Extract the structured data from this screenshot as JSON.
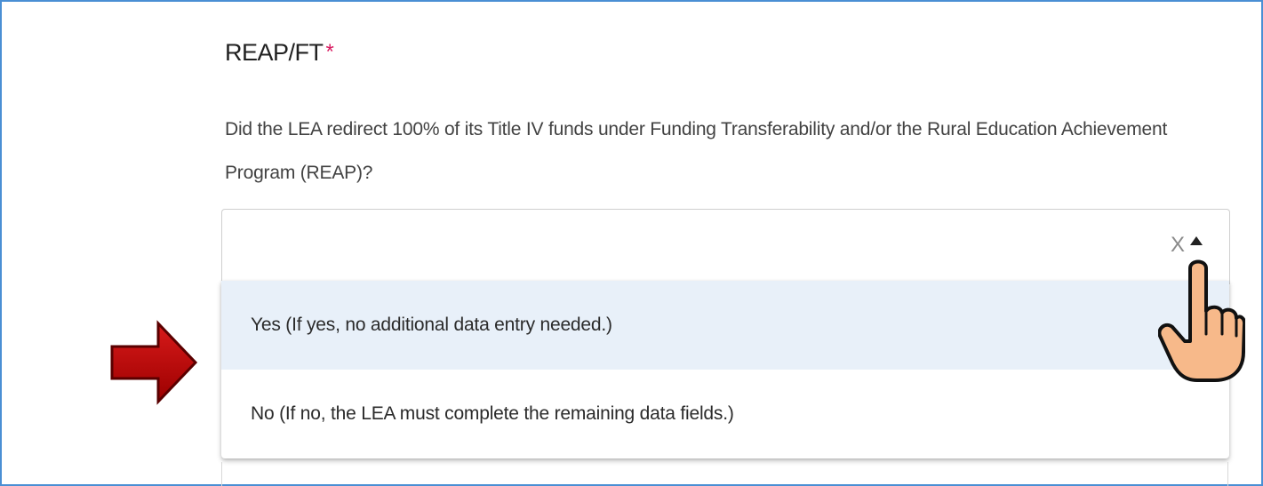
{
  "field": {
    "title": "REAP/FT",
    "required_marker": "*",
    "question": "Did the LEA redirect 100% of its Title IV funds under Funding Transferability and/or the Rural Education Achievement Program (REAP)?"
  },
  "select": {
    "clear_glyph": "X",
    "options": [
      {
        "label": "Yes (If yes, no additional data entry needed.)",
        "highlighted": true
      },
      {
        "label": "No (If no, the LEA must complete the remaining data fields.)",
        "highlighted": false
      }
    ]
  },
  "annotations": {
    "arrow_icon": "red-right-arrow-icon",
    "cursor_icon": "pointing-hand-cursor-icon",
    "arrow_color": "#c00000",
    "hand_color": "#f7b98a"
  }
}
